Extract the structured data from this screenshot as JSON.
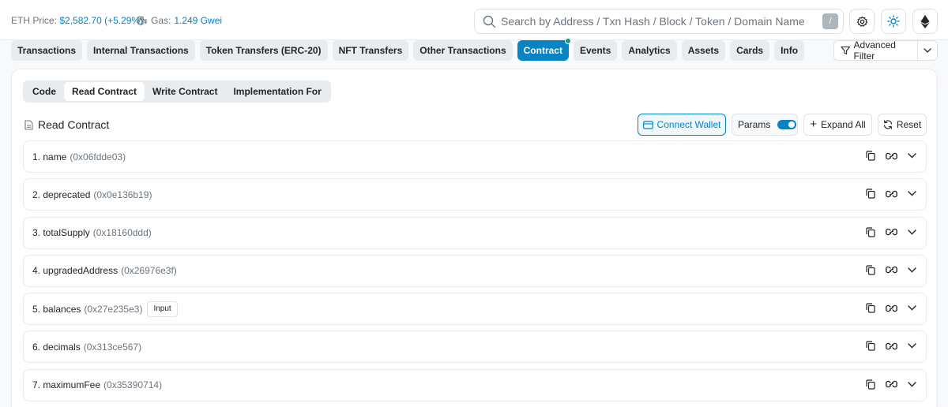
{
  "topbar": {
    "eth_price_label": "ETH Price:",
    "eth_price_value": "$2,582.70 (+5.29%)",
    "gas_label": "Gas:",
    "gas_value": "1.249 Gwei",
    "search_placeholder": "Search by Address / Txn Hash / Block / Token / Domain Name",
    "search_shortcut": "/"
  },
  "tabs": [
    {
      "label": "Transactions",
      "active": false
    },
    {
      "label": "Internal Transactions",
      "active": false
    },
    {
      "label": "Token Transfers (ERC-20)",
      "active": false
    },
    {
      "label": "NFT Transfers",
      "active": false
    },
    {
      "label": "Other Transactions",
      "active": false
    },
    {
      "label": "Contract",
      "active": true
    },
    {
      "label": "Events",
      "active": false
    },
    {
      "label": "Analytics",
      "active": false
    },
    {
      "label": "Assets",
      "active": false
    },
    {
      "label": "Cards",
      "active": false
    },
    {
      "label": "Info",
      "active": false
    }
  ],
  "advanced_filter_label": "Advanced Filter",
  "subtabs": [
    {
      "label": "Code",
      "active": false
    },
    {
      "label": "Read Contract",
      "active": true
    },
    {
      "label": "Write Contract",
      "active": false
    },
    {
      "label": "Implementation For",
      "active": false
    }
  ],
  "section_title": "Read Contract",
  "buttons": {
    "connect_wallet": "Connect Wallet",
    "params": "Params",
    "expand_all": "Expand All",
    "reset": "Reset"
  },
  "methods": [
    {
      "name": "1. name",
      "selector": "(0x06fdde03)",
      "badge": ""
    },
    {
      "name": "2. deprecated",
      "selector": "(0x0e136b19)",
      "badge": ""
    },
    {
      "name": "3. totalSupply",
      "selector": "(0x18160ddd)",
      "badge": ""
    },
    {
      "name": "4. upgradedAddress",
      "selector": "(0x26976e3f)",
      "badge": ""
    },
    {
      "name": "5. balances",
      "selector": "(0x27e235e3)",
      "badge": "Input"
    },
    {
      "name": "6. decimals",
      "selector": "(0x313ce567)",
      "badge": ""
    },
    {
      "name": "7. maximumFee",
      "selector": "(0x35390714)",
      "badge": ""
    }
  ],
  "colors": {
    "accent": "#0784c3",
    "tab_bg": "#e9ecef",
    "status_dot": "#00a186"
  },
  "icons": {
    "search": "search-icon",
    "gas": "gas-pump-icon",
    "settings": "gear-icon",
    "theme": "sun-icon",
    "network": "ethereum-icon",
    "filter": "filter-icon",
    "copy": "copy-icon",
    "link": "link-icon",
    "expand": "chevron-down-icon"
  }
}
